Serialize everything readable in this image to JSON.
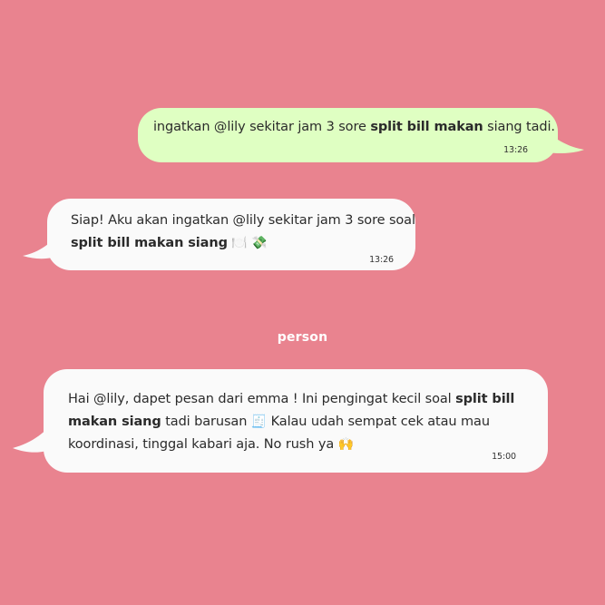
{
  "messages": {
    "m1": {
      "parts": [
        "ingatkan @lily sekitar jam 3 sore ",
        "split bill makan",
        " siang tadi."
      ],
      "time": "13:26"
    },
    "m2": {
      "line1": "Siap! Aku akan ingatkan @lily sekitar jam 3 sore soal",
      "bold": "split bill makan siang",
      "emoji1": "🍽️",
      "emoji2": "💸",
      "time": "13:26"
    },
    "sender_label": "person",
    "m3": {
      "pre": "Hai @lily, dapet pesan dari emma ! Ini pengingat kecil soal ",
      "bold": "split bill makan siang",
      "mid": " tadi barusan ",
      "emoji1": "🧾",
      "post": " Kalau udah sempat cek atau mau koordinasi, tinggal kabari aja. No rush ya ",
      "emoji2": "🙌",
      "time": "15:00"
    }
  },
  "colors": {
    "background": "#E9838F",
    "outgoing_bubble": "#DFFFC2",
    "incoming_bubble": "#FAFAFA",
    "sender_label": "#FFFFFF"
  }
}
